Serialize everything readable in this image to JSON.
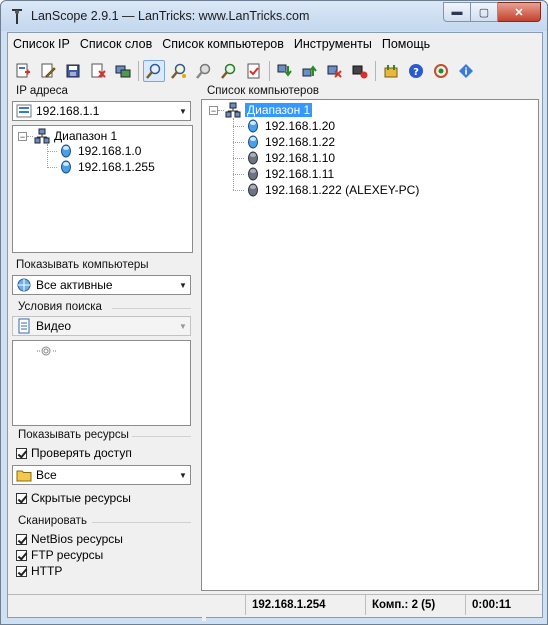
{
  "window": {
    "title": "LanScope 2.9.1 — LanTricks: www.LanTricks.com"
  },
  "caption_buttons": {
    "minimize": "▬",
    "maximize": "▢",
    "close": "✕"
  },
  "menu": [
    "Список IP",
    "Список слов",
    "Список компьютеров",
    "Инструменты",
    "Помощь"
  ],
  "toolbar": {
    "groups": [
      [
        "add-ip-icon",
        "edit-ip-icon",
        "save-ip-icon",
        "delete-ip-icon",
        "scan-ip-icon"
      ],
      [
        "search-icon",
        "search-wizard-icon",
        "find-icon",
        "find-next-icon",
        "checklist-icon"
      ],
      [
        "computer-down-icon",
        "computer-up-icon",
        "computer-remove-icon",
        "computer-stop-icon"
      ],
      [
        "plugin-icon",
        "help-icon",
        "update-icon",
        "info-icon"
      ]
    ]
  },
  "left": {
    "ip_label": "IP адреса",
    "ip_combo": "192.168.1.1",
    "ip_tree": {
      "root": "Диапазон 1",
      "children": [
        "192.168.1.0",
        "192.168.1.255"
      ]
    },
    "show_computers_label": "Показывать компьютеры",
    "show_computers_combo": "Все активные",
    "search_conditions_label": "Условия поиска",
    "search_conditions_combo": "Видео",
    "show_resources_label": "Показывать ресурсы",
    "check_access": "Проверять доступ",
    "resources_combo": "Все",
    "hidden_resources": "Скрытые ресурсы",
    "scan_label": "Сканировать",
    "scan_netbios": "NetBios ресурсы",
    "scan_ftp": "FTP ресурсы",
    "scan_http": "HTTP"
  },
  "right": {
    "label": "Список компьютеров",
    "tree": {
      "root": "Диапазон 1",
      "children": [
        "192.168.1.20",
        "192.168.1.22",
        "192.168.1.10",
        "192.168.1.11",
        "192.168.1.222 (ALEXEY-PC)"
      ]
    }
  },
  "status": {
    "empty": "",
    "ip": "192.168.1.254",
    "count": "Комп.: 2 (5)",
    "time": "0:00:11"
  },
  "colors": {
    "selection": "#3399ff",
    "frame": "#cfe0f2"
  }
}
